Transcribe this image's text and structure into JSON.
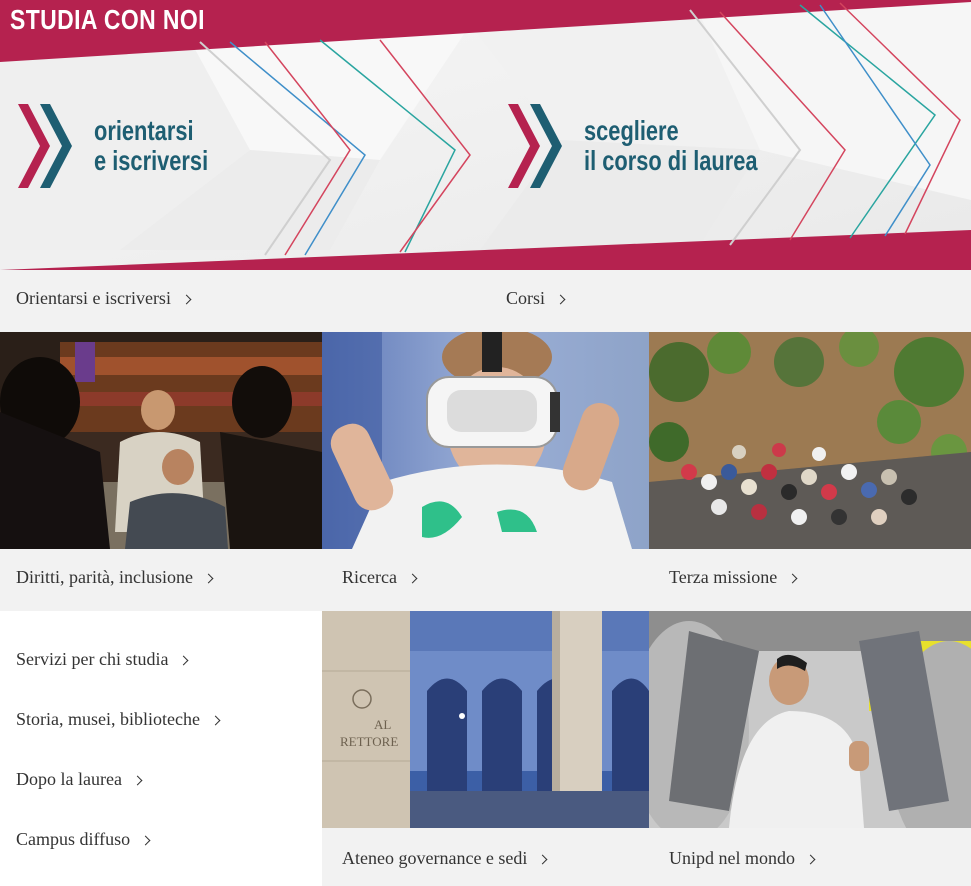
{
  "hero": {
    "title": "STUDIA CON NOI",
    "promos": [
      {
        "line1": "orientarsi",
        "line2": "e iscriversi",
        "icon": "double-chevron-icon"
      },
      {
        "line1": "scegliere",
        "line2": "il corso di laurea",
        "icon": "double-chevron-icon"
      }
    ],
    "links": [
      "Orientarsi e iscriversi",
      "Corsi"
    ]
  },
  "tiles": [
    {
      "label": "Diritti, parità, inclusione",
      "image": "students-sitting-photo"
    },
    {
      "label": "Ricerca",
      "image": "child-vr-headset-photo"
    },
    {
      "label": "Terza missione",
      "image": "botanical-garden-crowd-photo"
    },
    {
      "label": "Ateneo governance e sedi",
      "image": "al-rettore-building-photo"
    },
    {
      "label": "Unipd nel mondo",
      "image": "student-mechanical-structure-photo"
    }
  ],
  "side_links": [
    "Servizi per chi studia",
    "Storia, musei, biblioteche",
    "Dopo la laurea",
    "Campus diffuso"
  ],
  "photo_text": {
    "al": "AL",
    "rettore": "RETTORE"
  },
  "colors": {
    "brand_magenta": "#b5224f",
    "brand_teal": "#1e5e72",
    "label_bg": "#f2f2f2",
    "line_blue": "#3f8fc9",
    "line_red": "#d4455e",
    "line_teal": "#2aa5a0"
  }
}
